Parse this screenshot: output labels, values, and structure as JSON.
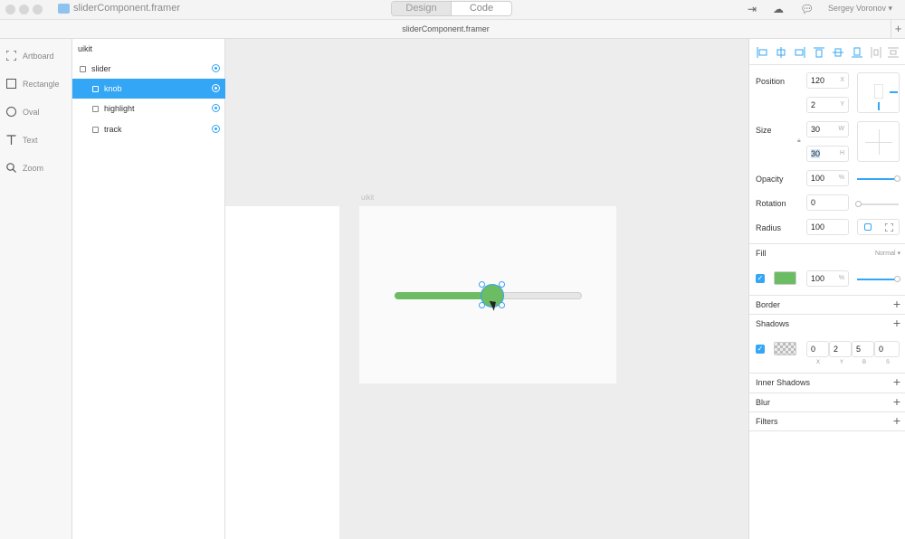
{
  "window": {
    "title": "sliderComponent.framer",
    "file_tab": "sliderComponent.framer",
    "mode_tabs": [
      "Design",
      "Code"
    ],
    "user": "Sergey Voronov"
  },
  "tools": [
    "Artboard",
    "Rectangle",
    "Oval",
    "Text",
    "Zoom"
  ],
  "layers": {
    "root": "uikit",
    "items": [
      {
        "label": "slider",
        "selected": false
      },
      {
        "label": "knob",
        "selected": true
      },
      {
        "label": "highlight",
        "selected": false
      },
      {
        "label": "track",
        "selected": false
      }
    ]
  },
  "canvas": {
    "artboard_label": "uikit",
    "slider_fill_fraction": 0.5
  },
  "properties": {
    "position_label": "Position",
    "x": "120",
    "x_unit": "X",
    "y": "2",
    "y_unit": "Y",
    "size_label": "Size",
    "w": "30",
    "w_unit": "W",
    "h": "30",
    "h_unit": "H",
    "opacity_label": "Opacity",
    "opacity": "100",
    "opacity_unit": "%",
    "rotation_label": "Rotation",
    "rotation": "0",
    "radius_label": "Radius",
    "radius": "100",
    "fill_label": "Fill",
    "fill_blend": "Normal",
    "fill_color": "#6cbc63",
    "fill_opacity": "100",
    "fill_opacity_unit": "%",
    "border_label": "Border",
    "shadows_label": "Shadows",
    "shadow_x": "0",
    "shadow_y": "2",
    "shadow_b": "5",
    "shadow_s": "0",
    "shadow_units": [
      "X",
      "Y",
      "B",
      "S"
    ],
    "inner_shadows_label": "Inner Shadows",
    "blur_label": "Blur",
    "filters_label": "Filters"
  },
  "colors": {
    "accent": "#33a6f6",
    "green": "#6cbc63"
  }
}
